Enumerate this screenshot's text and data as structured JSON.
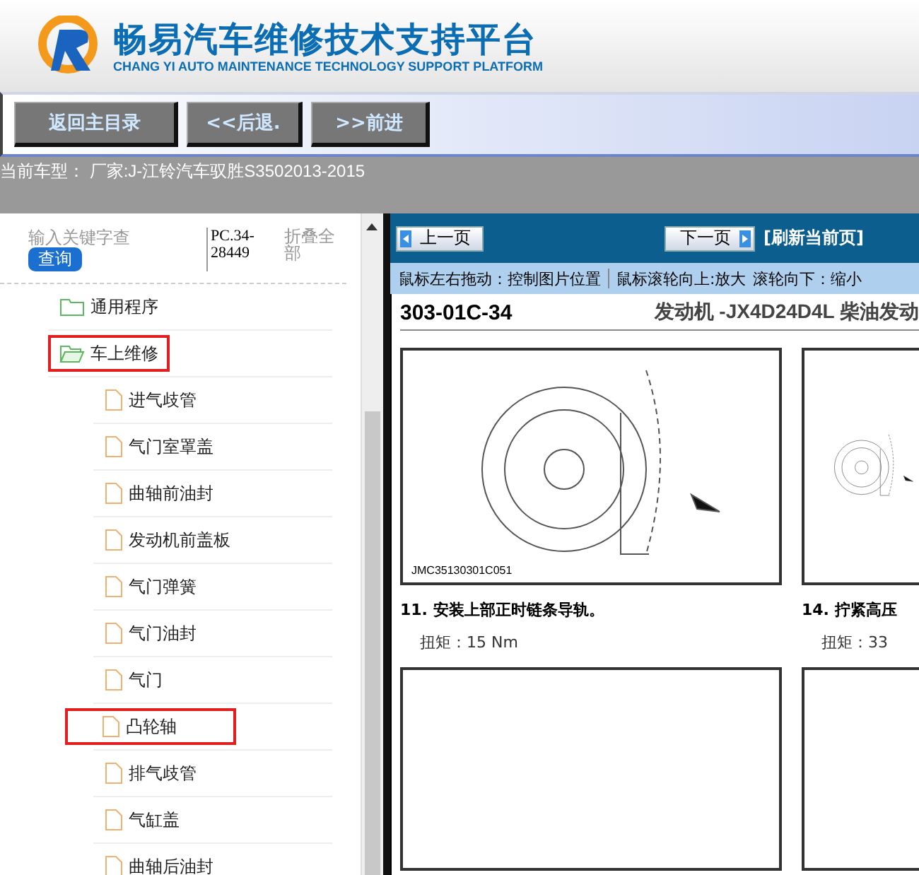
{
  "header": {
    "title": "畅易汽车维修技术支持平台",
    "subtitle": "CHANG YI AUTO MAINTENANCE TECHNOLOGY SUPPORT PLATFORM"
  },
  "nav_buttons": [
    "返回主目录",
    "<<后退.",
    ">>前进"
  ],
  "current_model": "当前车型： 厂家:J-江铃汽车驭胜S3502013-2015",
  "sidebar": {
    "search": {
      "placeholder": "输入关键字查"
    },
    "search_button": "查询",
    "code": "PC.34-28449",
    "collapse_all": "折叠全部",
    "tree": [
      {
        "label": "通用程序",
        "kind": "folder",
        "expanded": false,
        "highlighted": false
      },
      {
        "label": "车上维修",
        "kind": "folder",
        "expanded": true,
        "highlighted": true,
        "children": [
          {
            "label": "进气歧管",
            "kind": "page",
            "highlighted": false
          },
          {
            "label": "气门室罩盖",
            "kind": "page",
            "highlighted": false
          },
          {
            "label": "曲轴前油封",
            "kind": "page",
            "highlighted": false
          },
          {
            "label": "发动机前盖板",
            "kind": "page",
            "highlighted": false
          },
          {
            "label": "气门弹簧",
            "kind": "page",
            "highlighted": false
          },
          {
            "label": "气门油封",
            "kind": "page",
            "highlighted": false
          },
          {
            "label": "气门",
            "kind": "page",
            "highlighted": false
          },
          {
            "label": "凸轮轴",
            "kind": "page",
            "highlighted": true
          },
          {
            "label": "排气歧管",
            "kind": "page",
            "highlighted": false
          },
          {
            "label": "气缸盖",
            "kind": "page",
            "highlighted": false
          },
          {
            "label": "曲轴后油封",
            "kind": "page",
            "highlighted": false
          }
        ]
      }
    ]
  },
  "viewer": {
    "prev_button": "上一页",
    "next_button": "下一页",
    "refresh_link": "[刷新当前页]",
    "hints": [
      "鼠标左右拖动：控制图片位置",
      "鼠标滚轮向上:放大",
      "滚轮向下：缩小"
    ],
    "document": {
      "page_number": "303-01C-34",
      "title": "发动机 -JX4D24D4L 柴油发动",
      "steps": [
        {
          "figure_code": "JMC35130301C051",
          "caption": "11. 安装上部正时链条导轨。",
          "torque": "扭矩：15 Nm"
        },
        {
          "caption": "14. 拧紧高压",
          "torque": "扭矩：33"
        }
      ]
    }
  }
}
